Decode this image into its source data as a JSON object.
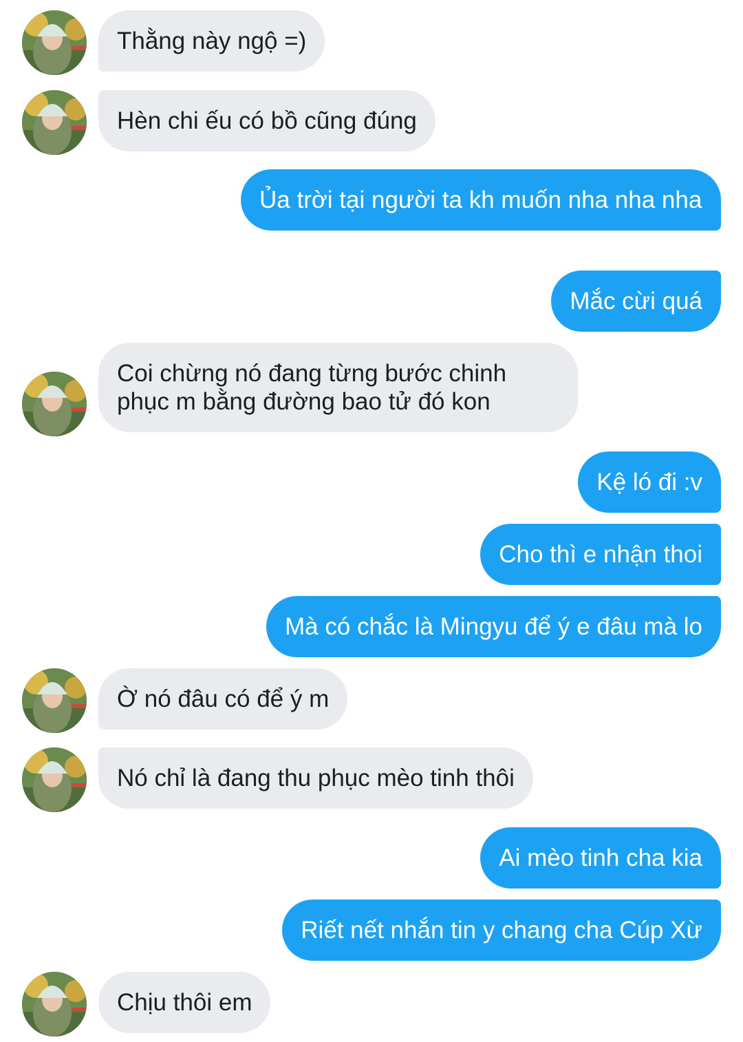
{
  "messages": [
    {
      "id": "m1",
      "direction": "in",
      "text": "Thằng này ngộ =)"
    },
    {
      "id": "m2",
      "direction": "in",
      "text": "Hèn chi ếu có bồ cũng đúng"
    },
    {
      "id": "m3",
      "direction": "out",
      "text": "Ủa trời tại người ta kh muốn nha nha nha"
    },
    {
      "id": "m4",
      "direction": "out",
      "text": "Mắc cừi quá"
    },
    {
      "id": "m5",
      "direction": "in",
      "text": "Coi chừng nó đang từng bước chinh phục m bằng đường bao tử đó kon"
    },
    {
      "id": "m6",
      "direction": "out",
      "text": "Kệ ló đi :v"
    },
    {
      "id": "m7",
      "direction": "out",
      "text": "Cho thì e nhận thoi"
    },
    {
      "id": "m8",
      "direction": "out",
      "text": "Mà có chắc là Mingyu để ý e đâu mà lo"
    },
    {
      "id": "m9",
      "direction": "in",
      "text": "Ờ nó đâu có để ý m"
    },
    {
      "id": "m10",
      "direction": "in",
      "text": "Nó chỉ là đang thu phục mèo tinh thôi"
    },
    {
      "id": "m11",
      "direction": "out",
      "text": "Ai mèo tinh cha kia"
    },
    {
      "id": "m12",
      "direction": "out",
      "text": "Riết nết nhắn tin y chang cha Cúp Xừ"
    },
    {
      "id": "m13",
      "direction": "in",
      "text": "Chịu thôi em"
    }
  ],
  "colors": {
    "incoming_bubble": "#e9ebef",
    "outgoing_bubble": "#1da1f2",
    "incoming_text": "#1c1e21",
    "outgoing_text": "#ffffff"
  },
  "avatar_icon": "contact-photo"
}
